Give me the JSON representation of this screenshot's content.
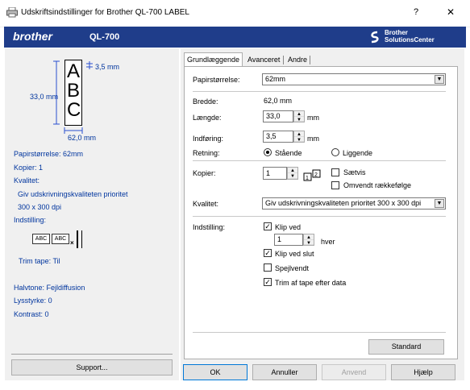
{
  "window": {
    "title": "Udskriftsindstillinger for Brother QL-700 LABEL",
    "help_btn": "?",
    "close_btn": "✕"
  },
  "banner": {
    "brand": "brother",
    "model": "QL-700",
    "solutions_line1": "Brother",
    "solutions_line2": "SolutionsCenter"
  },
  "preview": {
    "width_dim": "3,5 mm",
    "length_dim": "33,0 mm",
    "tape_dim": "62,0 mm",
    "letters": [
      "A",
      "B",
      "C"
    ]
  },
  "summary": {
    "paper_size": "Papirstørrelse: 62mm",
    "copies": "Kopier: 1",
    "quality_label": "Kvalitet:",
    "quality_line1": "Giv udskrivningskvaliteten prioritet",
    "quality_line2": "300 x 300 dpi",
    "setting_label": "Indstilling:",
    "cut_abc1": "ABC",
    "cut_abc2": "ABC",
    "trim_tape": "Trim tape: Til",
    "halftone": "Halvtone: Fejldiffusion",
    "brightness": "Lysstyrke:  0",
    "contrast": "Kontrast:  0"
  },
  "support_btn": "Support...",
  "tabs": [
    "Grundlæggende",
    "Avanceret",
    "Andre"
  ],
  "form": {
    "paper_size_label": "Papirstørrelse:",
    "paper_size_value": "62mm",
    "width_label": "Bredde:",
    "width_value": "62,0 mm",
    "length_label": "Længde:",
    "length_value": "33,0",
    "length_unit": "mm",
    "feed_label": "Indføring:",
    "feed_value": "3,5",
    "feed_unit": "mm",
    "orientation_label": "Retning:",
    "portrait": "Stående",
    "landscape": "Liggende",
    "copies_label": "Kopier:",
    "copies_value": "1",
    "collate": "Sætvis",
    "reverse": "Omvendt rækkefølge",
    "quality_label": "Kvalitet:",
    "quality_value": "Giv udskrivningskvaliteten prioritet 300 x 300 dpi",
    "setting_label": "Indstilling:",
    "cut_every": "Klip ved",
    "cut_every_value": "1",
    "cut_every_unit": "hver",
    "cut_at_end": "Klip ved slut",
    "mirror": "Spejlvendt",
    "trim_tape": "Trim af tape efter data",
    "standard_btn": "Standard"
  },
  "footer": {
    "ok": "OK",
    "cancel": "Annuller",
    "apply": "Anvend",
    "help": "Hjælp"
  },
  "colors": {
    "banner": "#1f3d8a",
    "summary_text": "#00359e"
  }
}
